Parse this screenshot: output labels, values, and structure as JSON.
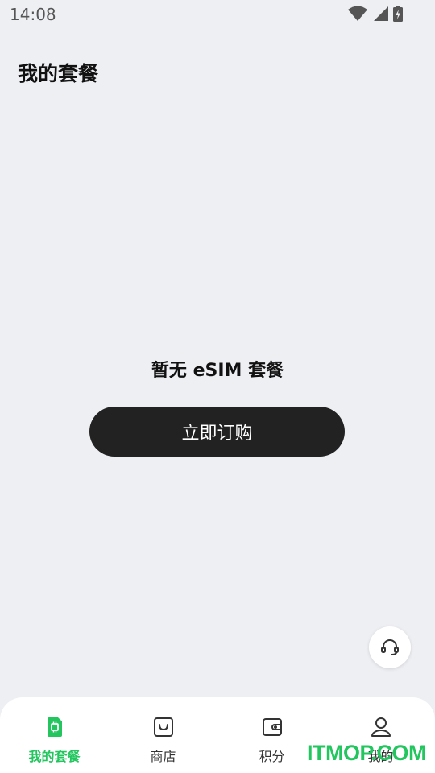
{
  "status_bar": {
    "time": "14:08",
    "icons": [
      "wifi-icon",
      "signal-icon",
      "battery-charging-icon"
    ]
  },
  "header": {
    "title": "我的套餐"
  },
  "empty_state": {
    "message": "暂无 eSIM 套餐",
    "button_label": "立即订购"
  },
  "support_fab": {
    "icon": "headset-icon"
  },
  "bottom_nav": {
    "items": [
      {
        "label": "我的套餐",
        "icon": "sim-card-icon",
        "active": true
      },
      {
        "label": "商店",
        "icon": "shopping-bag-icon",
        "active": false
      },
      {
        "label": "积分",
        "icon": "wallet-icon",
        "active": false
      },
      {
        "label": "我的",
        "icon": "user-icon",
        "active": false
      }
    ]
  },
  "watermark": {
    "text": "ITMOP.COM"
  },
  "colors": {
    "background": "#eeeff3",
    "accent": "#22c55e",
    "button": "#222222",
    "nav_background": "#ffffff"
  }
}
